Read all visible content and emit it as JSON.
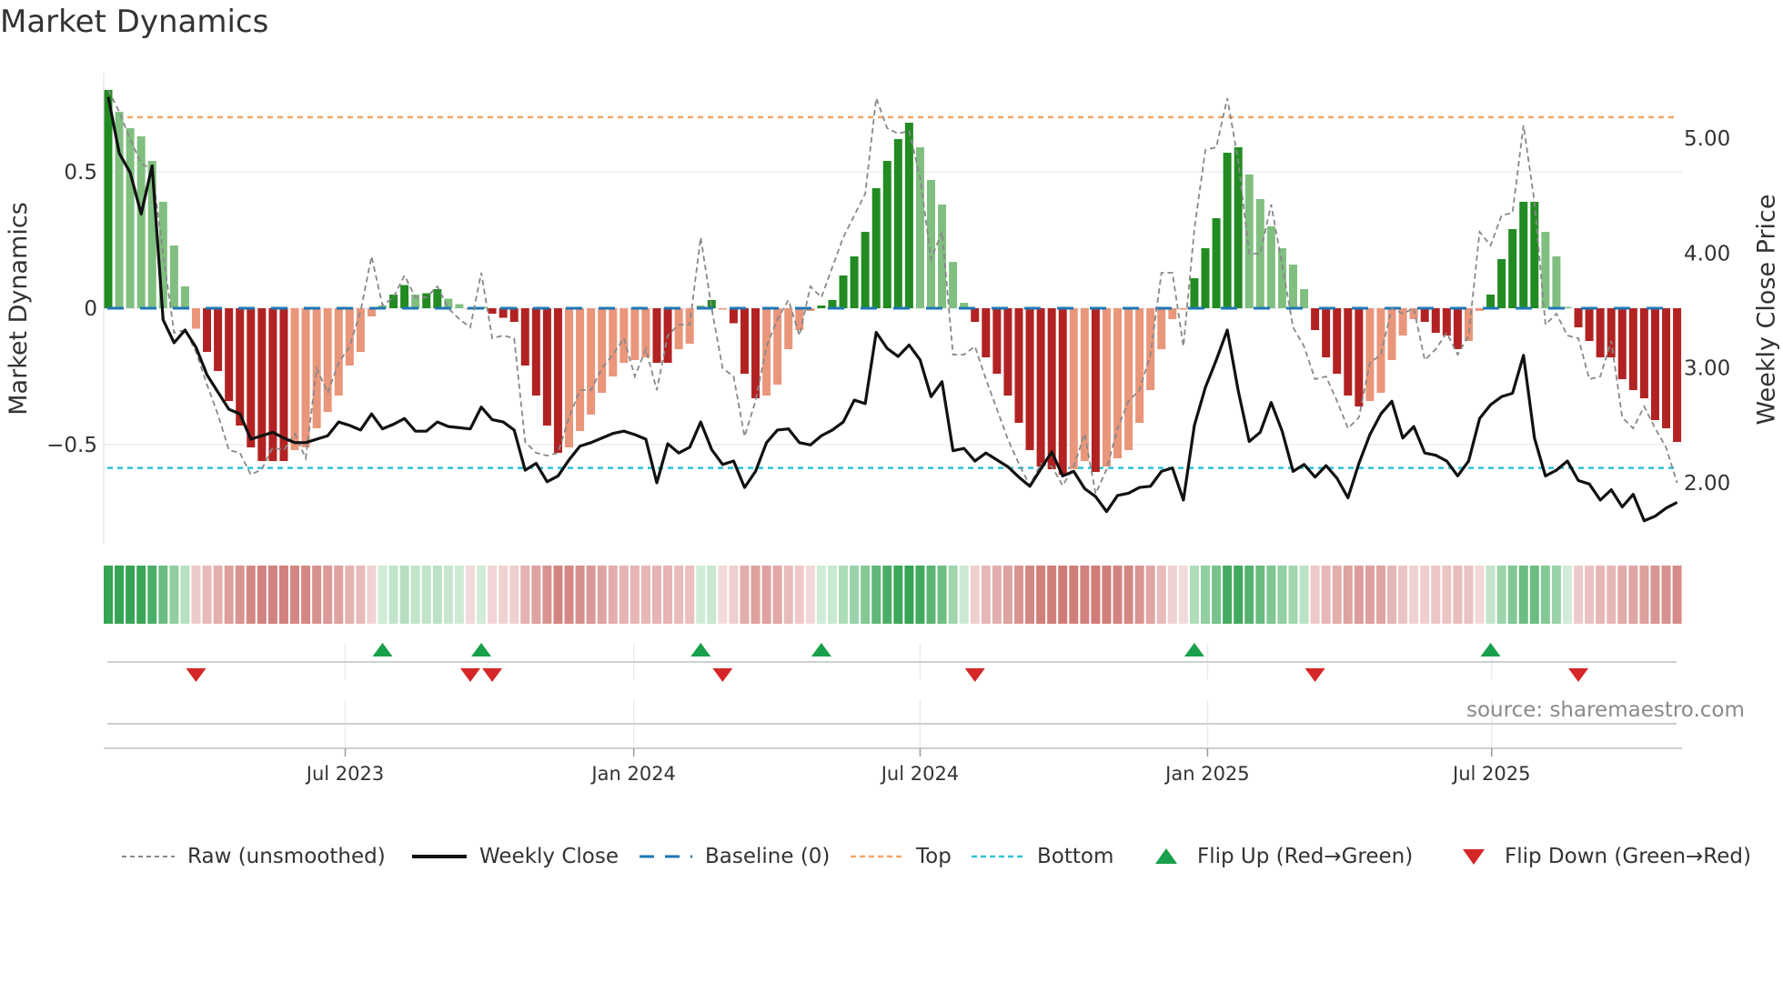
{
  "title": "Market Dynamics",
  "source": "source: sharemaestro.com",
  "chart_data": {
    "type": "bar",
    "title": "Market Dynamics",
    "ylabel": "Market Dynamics",
    "ylabel_right": "Weekly Close Price",
    "xlabel": "",
    "ylim": [
      -0.863,
      0.863
    ],
    "ylim_right": [
      1.47,
      5.57
    ],
    "yticks": [
      {
        "value": 0.5,
        "label": "0.5"
      },
      {
        "value": 0,
        "label": "0"
      },
      {
        "value": -0.5,
        "label": "−0.5"
      }
    ],
    "yticks_right": [
      {
        "value": 5,
        "label": "5.00"
      },
      {
        "value": 4,
        "label": "4.00"
      },
      {
        "value": 3,
        "label": "3.00"
      },
      {
        "value": 2,
        "label": "2.00"
      }
    ],
    "xticks": [
      {
        "label": "Jul 2023",
        "week": 21.6
      },
      {
        "label": "Jan 2024",
        "week": 47.9
      },
      {
        "label": "Jul 2024",
        "week": 74.0
      },
      {
        "label": "Jan 2025",
        "week": 100.2
      },
      {
        "label": "Jul 2025",
        "week": 126.1
      }
    ],
    "grid": true,
    "legend_position": "bottom",
    "thresholds": {
      "baseline": 0,
      "top": 0.7,
      "bottom": -0.585
    },
    "colors": {
      "green_strong": "#228b22",
      "green_weak": "#80bf80",
      "red_strong": "#b22222",
      "red_weak": "#e9967a",
      "raw": "#888888",
      "close": "#111111",
      "baseline": "#1f77b4",
      "top": "#f0a868",
      "bottom": "#2ec4d6",
      "flip_up": "#18a04a",
      "flip_down": "#d62728"
    },
    "series": [
      {
        "name": "Market Dynamics (smoothed)",
        "values": [
          0.8,
          0.72,
          0.66,
          0.63,
          0.54,
          0.39,
          0.23,
          0.08,
          -0.075,
          -0.16,
          -0.23,
          -0.34,
          -0.43,
          -0.51,
          -0.56,
          -0.56,
          -0.56,
          -0.52,
          -0.51,
          -0.44,
          -0.38,
          -0.32,
          -0.21,
          -0.16,
          -0.03,
          0.01,
          0.05,
          0.085,
          0.05,
          0.055,
          0.07,
          0.035,
          0.015,
          -0.005,
          0.005,
          -0.02,
          -0.035,
          -0.05,
          -0.21,
          -0.32,
          -0.43,
          -0.53,
          -0.51,
          -0.45,
          -0.39,
          -0.31,
          -0.25,
          -0.2,
          -0.19,
          -0.18,
          -0.2,
          -0.2,
          -0.15,
          -0.13,
          0.01,
          0.03,
          -0.005,
          -0.055,
          -0.24,
          -0.33,
          -0.32,
          -0.28,
          -0.15,
          -0.08,
          -0.01,
          0.01,
          0.03,
          0.12,
          0.19,
          0.28,
          0.44,
          0.54,
          0.62,
          0.68,
          0.59,
          0.47,
          0.38,
          0.17,
          0.02,
          -0.05,
          -0.18,
          -0.24,
          -0.32,
          -0.42,
          -0.52,
          -0.58,
          -0.59,
          -0.61,
          -0.59,
          -0.56,
          -0.6,
          -0.58,
          -0.55,
          -0.52,
          -0.42,
          -0.3,
          -0.15,
          -0.04,
          -0.005,
          0.11,
          0.22,
          0.33,
          0.57,
          0.59,
          0.49,
          0.4,
          0.3,
          0.22,
          0.16,
          0.07,
          -0.08,
          -0.18,
          -0.24,
          -0.32,
          -0.36,
          -0.34,
          -0.31,
          -0.19,
          -0.1,
          -0.04,
          -0.05,
          -0.09,
          -0.1,
          -0.15,
          -0.12,
          -0.01,
          0.05,
          0.18,
          0.29,
          0.39,
          0.39,
          0.28,
          0.19,
          0.005,
          -0.07,
          -0.12,
          -0.18,
          -0.18,
          -0.26,
          -0.3,
          -0.33,
          -0.41,
          -0.44,
          -0.49
        ]
      },
      {
        "name": "Raw (unsmoothed)",
        "values": [
          0.8,
          0.72,
          0.62,
          0.53,
          0.51,
          0.2,
          -0.09,
          -0.08,
          -0.16,
          -0.28,
          -0.39,
          -0.52,
          -0.53,
          -0.61,
          -0.59,
          -0.51,
          -0.52,
          -0.46,
          -0.55,
          -0.22,
          -0.31,
          -0.2,
          -0.14,
          -0.01,
          0.19,
          0.01,
          0.04,
          0.12,
          0.04,
          0.04,
          0.08,
          0.0,
          -0.04,
          -0.07,
          0.13,
          -0.11,
          -0.1,
          -0.11,
          -0.49,
          -0.53,
          -0.54,
          -0.53,
          -0.4,
          -0.3,
          -0.3,
          -0.22,
          -0.17,
          -0.11,
          -0.25,
          -0.15,
          -0.3,
          -0.1,
          -0.06,
          -0.06,
          0.26,
          0.0,
          -0.22,
          -0.25,
          -0.47,
          -0.34,
          -0.14,
          -0.04,
          0.03,
          -0.1,
          0.08,
          0.04,
          0.15,
          0.26,
          0.34,
          0.42,
          0.77,
          0.66,
          0.64,
          0.65,
          0.48,
          0.18,
          0.28,
          -0.17,
          -0.17,
          -0.14,
          -0.26,
          -0.37,
          -0.48,
          -0.57,
          -0.65,
          -0.57,
          -0.58,
          -0.65,
          -0.58,
          -0.46,
          -0.68,
          -0.59,
          -0.44,
          -0.34,
          -0.3,
          -0.17,
          0.13,
          0.13,
          -0.14,
          0.29,
          0.58,
          0.59,
          0.77,
          0.54,
          0.2,
          0.2,
          0.38,
          0.16,
          -0.07,
          -0.14,
          -0.26,
          -0.25,
          -0.34,
          -0.44,
          -0.4,
          -0.2,
          -0.17,
          0.0,
          -0.02,
          0.0,
          -0.19,
          -0.15,
          -0.09,
          -0.17,
          -0.1,
          0.28,
          0.23,
          0.34,
          0.35,
          0.67,
          0.39,
          -0.06,
          -0.02,
          -0.1,
          -0.11,
          -0.26,
          -0.25,
          -0.12,
          -0.4,
          -0.44,
          -0.36,
          -0.44,
          -0.51,
          -0.64
        ]
      },
      {
        "name": "Weekly Close",
        "axis": "right",
        "values": [
          5.36,
          4.87,
          4.7,
          4.34,
          4.76,
          3.42,
          3.22,
          3.33,
          3.18,
          2.94,
          2.79,
          2.64,
          2.6,
          2.38,
          2.41,
          2.44,
          2.39,
          2.35,
          2.35,
          2.38,
          2.41,
          2.53,
          2.5,
          2.46,
          2.6,
          2.47,
          2.51,
          2.56,
          2.45,
          2.45,
          2.53,
          2.49,
          2.48,
          2.47,
          2.66,
          2.55,
          2.53,
          2.46,
          2.11,
          2.17,
          2.01,
          2.06,
          2.2,
          2.32,
          2.35,
          2.39,
          2.43,
          2.45,
          2.42,
          2.38,
          2.0,
          2.34,
          2.26,
          2.31,
          2.53,
          2.29,
          2.16,
          2.19,
          1.96,
          2.1,
          2.35,
          2.46,
          2.47,
          2.35,
          2.33,
          2.41,
          2.46,
          2.53,
          2.72,
          2.69,
          3.31,
          3.17,
          3.1,
          3.2,
          3.07,
          2.75,
          2.88,
          2.28,
          2.3,
          2.19,
          2.26,
          2.2,
          2.14,
          2.05,
          1.97,
          2.12,
          2.27,
          2.06,
          2.1,
          1.95,
          1.88,
          1.75,
          1.89,
          1.91,
          1.96,
          1.97,
          2.1,
          2.13,
          1.85,
          2.5,
          2.83,
          3.07,
          3.33,
          2.8,
          2.36,
          2.44,
          2.7,
          2.45,
          2.1,
          2.16,
          2.05,
          2.15,
          2.04,
          1.87,
          2.17,
          2.42,
          2.6,
          2.71,
          2.39,
          2.49,
          2.26,
          2.24,
          2.19,
          2.06,
          2.19,
          2.56,
          2.68,
          2.75,
          2.78,
          3.11,
          2.39,
          2.06,
          2.11,
          2.19,
          2.02,
          1.99,
          1.85,
          1.94,
          1.79,
          1.9,
          1.67,
          1.71,
          1.78,
          1.83
        ]
      }
    ],
    "flips": {
      "up_weeks": [
        25,
        34,
        54,
        65,
        99,
        126
      ],
      "down_weeks": [
        8,
        33,
        35,
        56,
        79,
        110,
        134
      ]
    },
    "legend": {
      "raw": "Raw (unsmoothed)",
      "close": "Weekly Close",
      "baseline": "Baseline (0)",
      "top": "Top",
      "bottom": "Bottom",
      "flip_up": "Flip Up (Red→Green)",
      "flip_down": "Flip Down (Green→Red)"
    }
  }
}
